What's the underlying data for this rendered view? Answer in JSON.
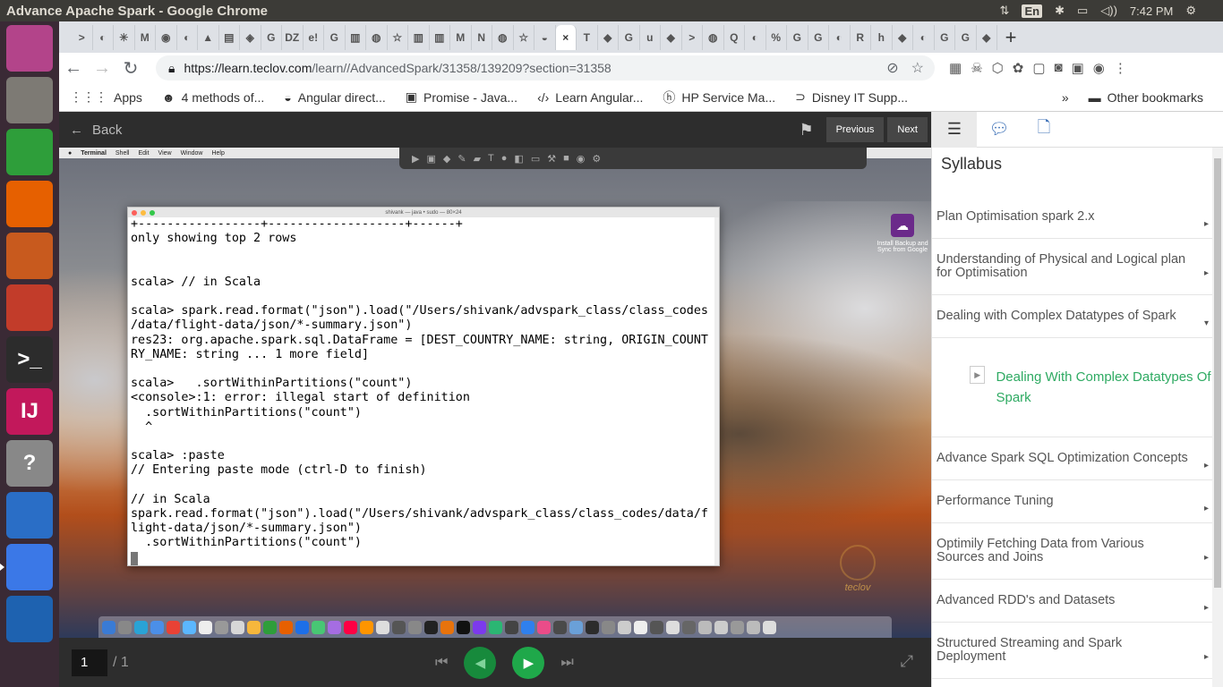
{
  "system": {
    "window_title": "Advance Apache Spark - Google Chrome",
    "lang": "En",
    "time": "7:42 PM"
  },
  "launcher": [
    {
      "name": "ubuntu-dash-icon",
      "color": "#b3448a"
    },
    {
      "name": "files-icon",
      "color": "#7d7a74"
    },
    {
      "name": "spreadsheet-icon",
      "color": "#2e9e3a"
    },
    {
      "name": "firefox-icon",
      "color": "#e66000"
    },
    {
      "name": "presentation-icon",
      "color": "#c85a1e"
    },
    {
      "name": "settings-icon",
      "color": "#c23c2a"
    },
    {
      "name": "terminal-icon",
      "color": "#2c2c2c"
    },
    {
      "name": "intellij-icon",
      "color": "#c2185b"
    },
    {
      "name": "help-icon",
      "color": "#888"
    },
    {
      "name": "document-icon",
      "color": "#2a6ec6"
    },
    {
      "name": "chrome-icon",
      "color": "#3b78e7"
    },
    {
      "name": "virtualbox-icon",
      "color": "#1e62b0"
    }
  ],
  "launcher_labels": {
    "intellij": "IJ",
    "terminal": ">_",
    "help": "?"
  },
  "tabs": [
    ">",
    "◐",
    "✳",
    "M",
    "◉",
    "◐",
    "▲",
    "▤",
    "◈",
    "G",
    "DZ",
    "e!",
    "G",
    "▥",
    "◍",
    "☆",
    "▥",
    "▥",
    "M",
    "N",
    "◍",
    "☆",
    "◒",
    "×",
    "T",
    "◆",
    "G",
    "u",
    "◆",
    ">",
    "◍",
    "Q",
    "◐",
    "%",
    "G",
    "G",
    "◐",
    "R",
    "h",
    "◆",
    "◐",
    "G",
    "G",
    "◆"
  ],
  "active_tab_index": 23,
  "new_tab_label": "+",
  "address": {
    "host": "https://learn.teclov.com",
    "path": "/learn//AdvancedSpark/31358/139209?section=31358"
  },
  "bookmarks": [
    {
      "icon": "⋮⋮⋮",
      "label": "Apps"
    },
    {
      "icon": "☻",
      "label": "4 methods of..."
    },
    {
      "icon": "◒",
      "label": "Angular direct..."
    },
    {
      "icon": "▣",
      "label": "Promise - Java..."
    },
    {
      "icon": "‹/›",
      "label": "Learn Angular..."
    },
    {
      "icon": "ⓗ",
      "label": "HP Service Ma..."
    },
    {
      "icon": "⊃",
      "label": "Disney IT Supp..."
    }
  ],
  "bookmarks_more": "»",
  "other_bookmarks": "Other bookmarks",
  "player": {
    "back_label": "Back",
    "previous_label": "Previous",
    "next_label": "Next",
    "page": "1",
    "pages": "/ 1"
  },
  "mac": {
    "menu": [
      "Terminal",
      "Shell",
      "Edit",
      "View",
      "Window",
      "Help"
    ],
    "terminal_title": "shivank — java • sudo — 80×24",
    "desktop_icon_label": "Install Backup and Sync from Google"
  },
  "terminal_lines": [
    "+-----------------+-------------------+------+",
    "only showing top 2 rows",
    "",
    "",
    "scala> // in Scala",
    "",
    "scala> spark.read.format(\"json\").load(\"/Users/shivank/advspark_class/class_codes",
    "/data/flight-data/json/*-summary.json\")",
    "res23: org.apache.spark.sql.DataFrame = [DEST_COUNTRY_NAME: string, ORIGIN_COUNT",
    "RY_NAME: string ... 1 more field]",
    "",
    "scala>   .sortWithinPartitions(\"count\")",
    "<console>:1: error: illegal start of definition",
    "  .sortWithinPartitions(\"count\")",
    "  ^",
    "",
    "scala> :paste",
    "// Entering paste mode (ctrl-D to finish)",
    "",
    "// in Scala",
    "spark.read.format(\"json\").load(\"/Users/shivank/advspark_class/class_codes/data/f",
    "light-data/json/*-summary.json\")",
    "  .sortWithinPartitions(\"count\")"
  ],
  "watermark": "teclov",
  "sidebar": {
    "heading": "Syllabus",
    "items": [
      {
        "label": "Plan Optimisation spark 2.x",
        "arrow": "▸"
      },
      {
        "label": "Understanding of Physical and Logical plan for Optimisation",
        "arrow": "▸"
      },
      {
        "label": "Dealing with Complex Datatypes of Spark",
        "arrow": "▾"
      }
    ],
    "sub_item": "Dealing With Complex Datatypes Of Spark",
    "items2": [
      {
        "label": "Advance Spark SQL Optimization Concepts",
        "arrow": "▸"
      },
      {
        "label": "Performance Tuning",
        "arrow": "▸"
      },
      {
        "label": "Optimily Fetching Data from Various Sources and Joins",
        "arrow": "▸"
      },
      {
        "label": "Advanced RDD's and Datasets",
        "arrow": "▸"
      },
      {
        "label": "Structured Streaming and Spark Deployment",
        "arrow": "▸"
      }
    ]
  },
  "colors": {
    "accent_green": "#1fa84a",
    "link_green": "#2eaa62",
    "chrome_tabstrip": "#dee1e6",
    "launcher": "#3a2a35"
  }
}
